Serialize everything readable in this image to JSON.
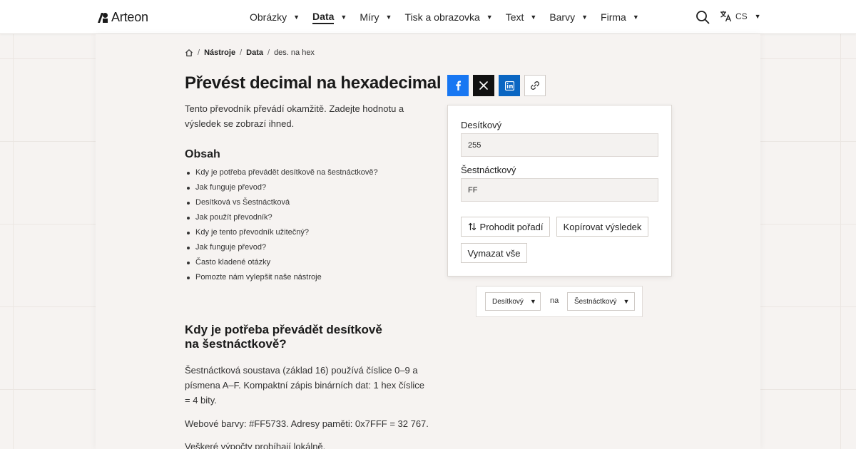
{
  "brand": {
    "name": "Arteon"
  },
  "nav": {
    "items": [
      {
        "label": "Obrázky",
        "active": false
      },
      {
        "label": "Data",
        "active": true
      },
      {
        "label": "Míry",
        "active": false
      },
      {
        "label": "Tisk a obrazovka",
        "active": false
      },
      {
        "label": "Text",
        "active": false
      },
      {
        "label": "Barvy",
        "active": false
      },
      {
        "label": "Firma",
        "active": false
      }
    ],
    "caret": "▼",
    "language": "CS"
  },
  "breadcrumb": {
    "items": [
      "Nástroje",
      "Data",
      "des. na hex"
    ],
    "separator": "/"
  },
  "page": {
    "title": "Převést decimal na hexadecimal",
    "intro": "Tento převodník převádí okamžitě. Zadejte hodnotu a výsledek se zobrazí ihned."
  },
  "toc": {
    "title": "Obsah",
    "items": [
      "Kdy je potřeba převádět desítkově na šestnáctkově?",
      "Jak funguje převod?",
      "Desítková vs Šestnáctková",
      "Jak použít převodník?",
      "Kdy je tento převodník užitečný?",
      "Jak funguje převod?",
      "Často kladené otázky",
      "Pomozte nám vylepšit naše nástroje"
    ]
  },
  "section": {
    "title": "Kdy je potřeba převádět desítkově na šestnáctkově?",
    "paragraphs": [
      "Šestnáctková soustava (základ 16) používá číslice 0–9 a písmena A–F. Kompaktní zápis binárních dat: 1 hex číslice = 4 bity.",
      "Webové barvy: #FF5733. Adresy paměti: 0x7FFF = 32 767.",
      "Veškeré výpočty probíhají lokálně."
    ]
  },
  "share": {
    "icons": [
      "facebook-icon",
      "x-icon",
      "linkedin-icon",
      "link-icon"
    ],
    "colors": {
      "facebook": "#1877f2",
      "x": "#111111",
      "linkedin": "#0a66c2"
    }
  },
  "converter": {
    "decimal_label": "Desítkový",
    "decimal_value": "255",
    "hex_label": "Šestnáctkový",
    "hex_value": "FF",
    "swap_label": "Prohodit pořadí",
    "copy_label": "Kopírovat výsledek",
    "clear_label": "Vymazat vše"
  },
  "units": {
    "from": "Desítkový",
    "connector": "na",
    "to": "Šestnáctkový"
  }
}
